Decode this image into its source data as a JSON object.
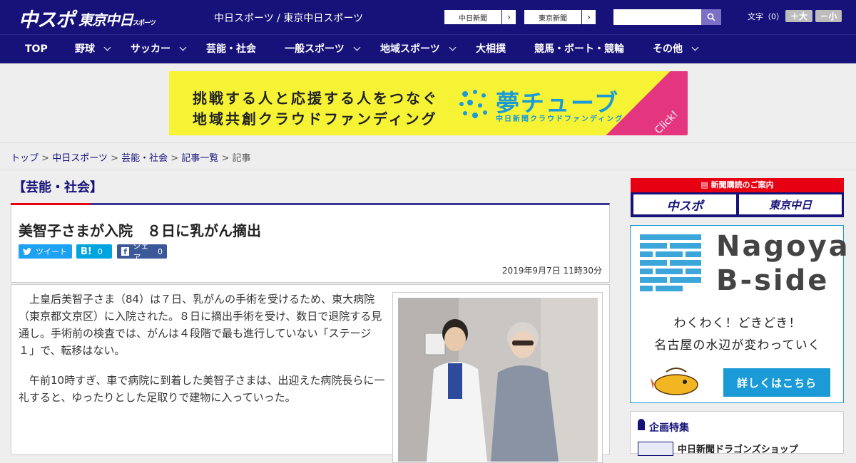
{
  "header": {
    "logo_chuspo": "中スポ",
    "logo_tokyo": "東京中日",
    "logo_tokyo_suffix": "スポーツ",
    "site_title": "中日スポーツ / 東京中日スポーツ",
    "btn_chunichi": "中日新聞",
    "btn_tokyo": "東京新聞",
    "font_label": "文字（0）",
    "font_large": "＋大",
    "font_small": "－小"
  },
  "nav": {
    "items": [
      {
        "label": "TOP"
      },
      {
        "label": "野球"
      },
      {
        "label": "サッカー"
      },
      {
        "label": "芸能・社会"
      },
      {
        "label": "一般スポーツ"
      },
      {
        "label": "地域スポーツ"
      },
      {
        "label": "大相撲"
      },
      {
        "label": "競馬・ボート・競輪"
      },
      {
        "label": "その他"
      }
    ]
  },
  "ad": {
    "line1": "挑戦する人と応援する人をつなぐ",
    "line2": "地域共創クラウドファンディング",
    "brand": "夢チューブ",
    "brand_sub": "中日新聞クラウドファンディング",
    "click": "Click!"
  },
  "breadcrumb": {
    "items": [
      "トップ",
      "中日スポーツ",
      "芸能・社会",
      "記事一覧"
    ],
    "sep": " > ",
    "current": "記事"
  },
  "article": {
    "category": "【芸能・社会】",
    "title": "美智子さまが入院　８日に乳がん摘出",
    "share_tweet": "ツイート",
    "share_hatena_count": "0",
    "share_fb": "シェア",
    "share_fb_count": "0",
    "date": "2019年9月7日 11時30分",
    "p1": "　上皇后美智子さま（84）は７日、乳がんの手術を受けるため、東大病院（東京都文京区）に入院された。８日に摘出手術を受け、数日で退院する見通し。手術前の検査では、がんは４段階で最も進行していない「ステージ１」で、転移はない。",
    "p2": "　午前10時すぎ、車で病院に到着した美智子さまは、出迎えた病院長らに一礼すると、ゆったりとした足取りで建物に入っていった。"
  },
  "sidebar": {
    "subscribe_label": "新聞購読のご案内",
    "sub_chuspo": "中スポ",
    "sub_tokyo": "東京中日",
    "nagoya_title_1": "Nagoya",
    "nagoya_title_2": "B-side",
    "nagoya_t1": "わくわく！どきどき！",
    "nagoya_t2": "名古屋の水辺が変わっていく",
    "nagoya_btn": "詳しくはこちら",
    "feat_title": "企画特集",
    "feat_item": "中日新聞ドラゴンズショップ"
  },
  "colors": {
    "brand_navy": "#16127a",
    "accent_red": "#e60012",
    "ad_yellow": "#f6f335",
    "ad_blue": "#1a9ad6"
  }
}
